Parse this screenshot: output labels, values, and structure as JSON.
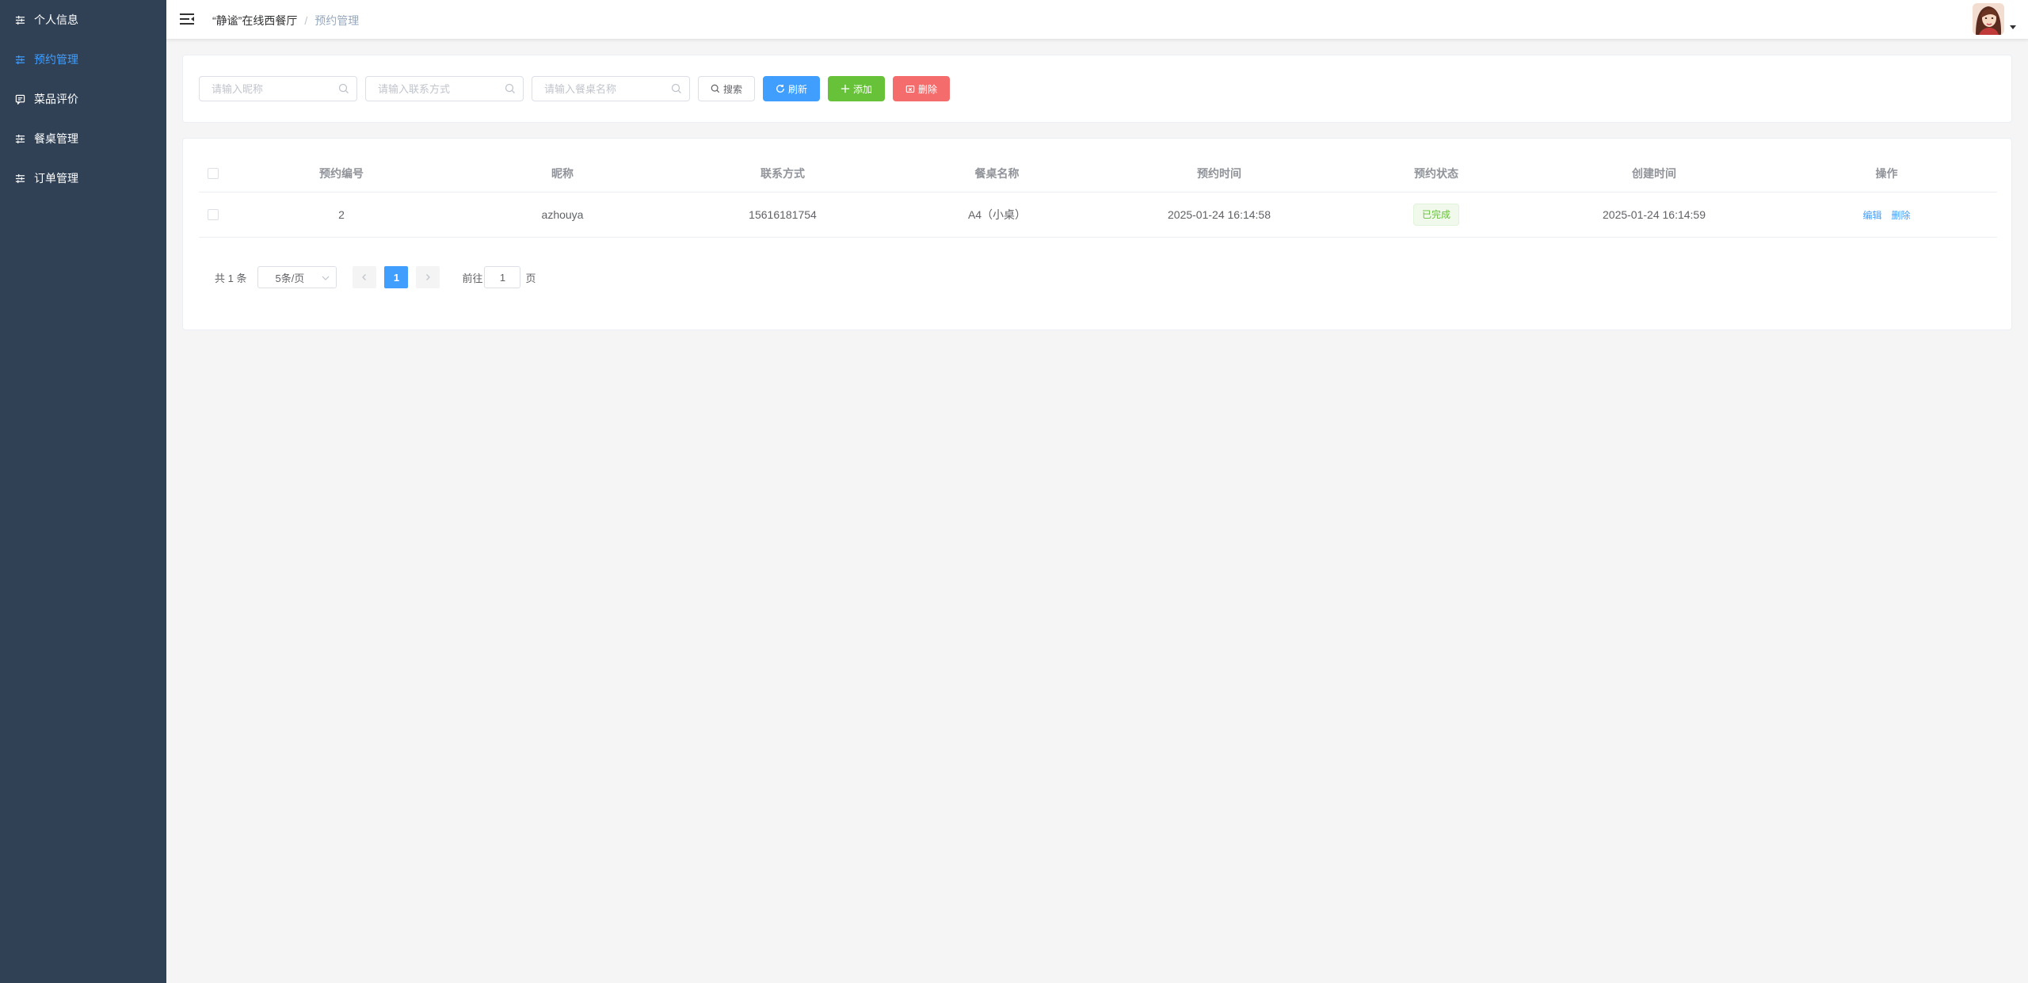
{
  "sidebar": {
    "items": [
      {
        "label": "个人信息",
        "icon": "sliders-icon",
        "active": false
      },
      {
        "label": "预约管理",
        "icon": "sliders-icon",
        "active": true
      },
      {
        "label": "菜品评价",
        "icon": "message-icon",
        "active": false
      },
      {
        "label": "餐桌管理",
        "icon": "sliders-icon",
        "active": false
      },
      {
        "label": "订单管理",
        "icon": "sliders-icon",
        "active": false
      }
    ]
  },
  "header": {
    "breadcrumb": [
      "“静谧”在线西餐厅",
      "预约管理"
    ],
    "breadcrumb_separator": "/"
  },
  "search": {
    "nickname_placeholder": "请输入昵称",
    "contact_placeholder": "请输入联系方式",
    "table_placeholder": "请输入餐桌名称",
    "search_label": "搜索",
    "refresh_label": "刷新",
    "add_label": "添加",
    "delete_label": "删除"
  },
  "table": {
    "columns": [
      "预约编号",
      "昵称",
      "联系方式",
      "餐桌名称",
      "预约时间",
      "预约状态",
      "创建时间",
      "操作"
    ],
    "rows": [
      {
        "id": "2",
        "nickname": "azhouya",
        "contact": "15616181754",
        "table_name": "A4（小桌）",
        "reserve_time": "2025-01-24 16:14:58",
        "status": "已完成",
        "created_time": "2025-01-24 16:14:59",
        "edit_label": "编辑",
        "delete_label": "删除"
      }
    ]
  },
  "pagination": {
    "total_text": "共 1 条",
    "page_size": "5条/页",
    "current_page": "1",
    "goto_prefix": "前往",
    "goto_value": "1",
    "goto_suffix": "页"
  },
  "colors": {
    "sidebar_bg": "#304156",
    "accent": "#409eff",
    "success": "#67c23a",
    "danger": "#f56c6c"
  }
}
